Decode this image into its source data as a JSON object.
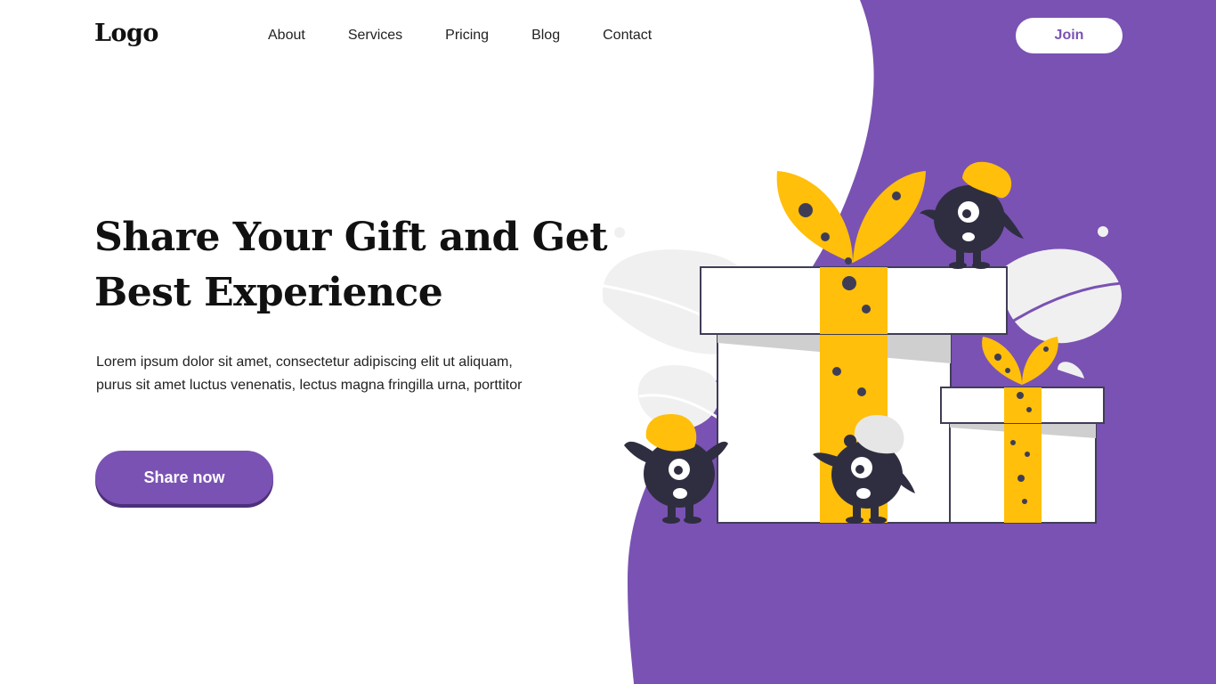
{
  "header": {
    "logo": "Logo",
    "nav": [
      "About",
      "Services",
      "Pricing",
      "Blog",
      "Contact"
    ],
    "join_label": "Join"
  },
  "hero": {
    "title_line1": "Share Your Gift and Get",
    "title_line2": "Best Experience",
    "description": "Lorem ipsum dolor sit amet, consectetur adipiscing elit ut aliquam, purus sit amet luctus venenatis, lectus magna fringilla urna, porttitor",
    "cta_label": "Share now"
  },
  "colors": {
    "brand_purple": "#7a52b3",
    "accent_yellow": "#ffbf0a",
    "dark": "#2f2e41"
  },
  "illustration": {
    "icons": [
      "gift-box-large",
      "gift-box-small",
      "monster-character"
    ]
  }
}
